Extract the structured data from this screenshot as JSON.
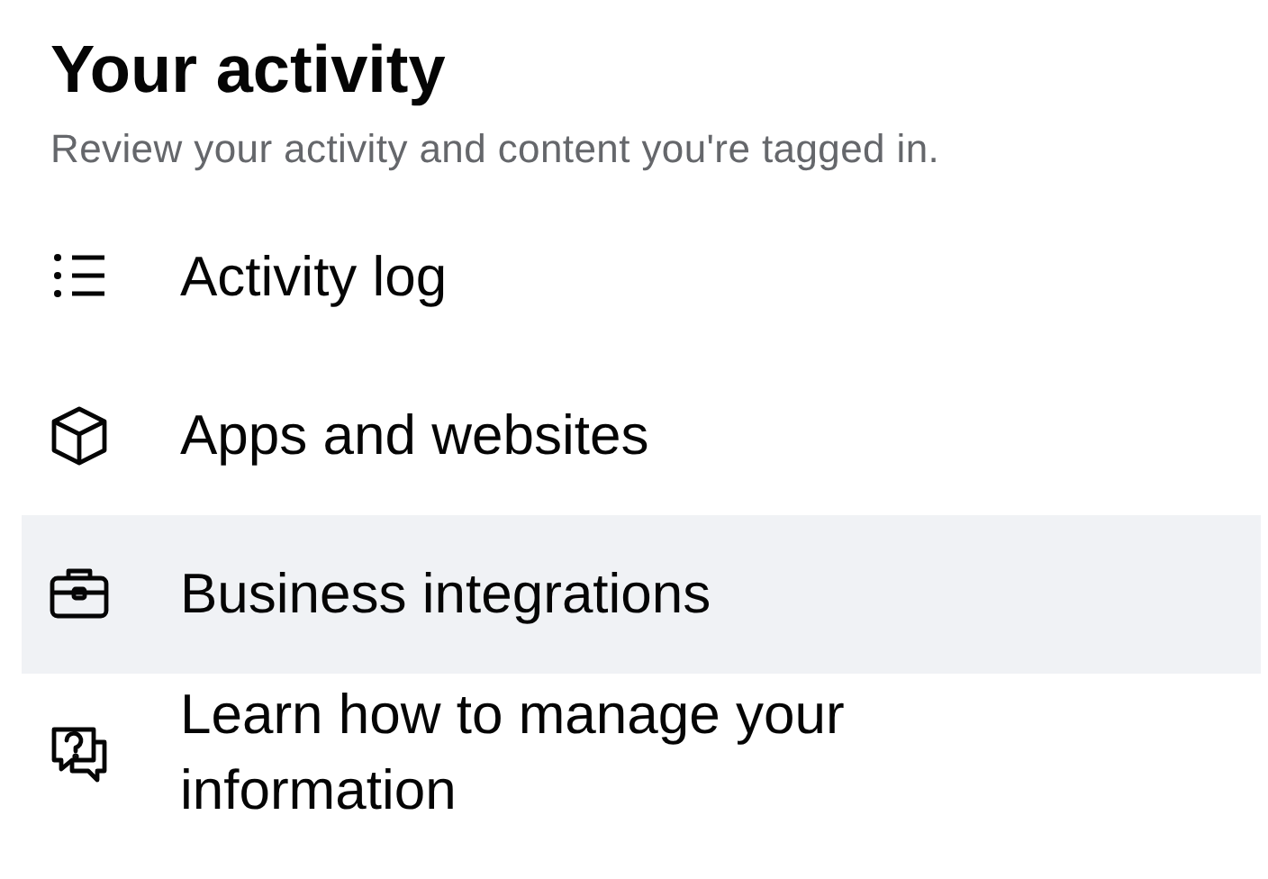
{
  "header": {
    "title": "Your activity",
    "subtitle": "Review your activity and content you're tagged in."
  },
  "items": [
    {
      "kind": "list",
      "label": "Activity log",
      "selected": false
    },
    {
      "kind": "cube",
      "label": "Apps and websites",
      "selected": false
    },
    {
      "kind": "briefcase",
      "label": "Business integrations",
      "selected": true
    },
    {
      "kind": "help",
      "label": "Learn how to manage your information",
      "selected": false
    }
  ]
}
